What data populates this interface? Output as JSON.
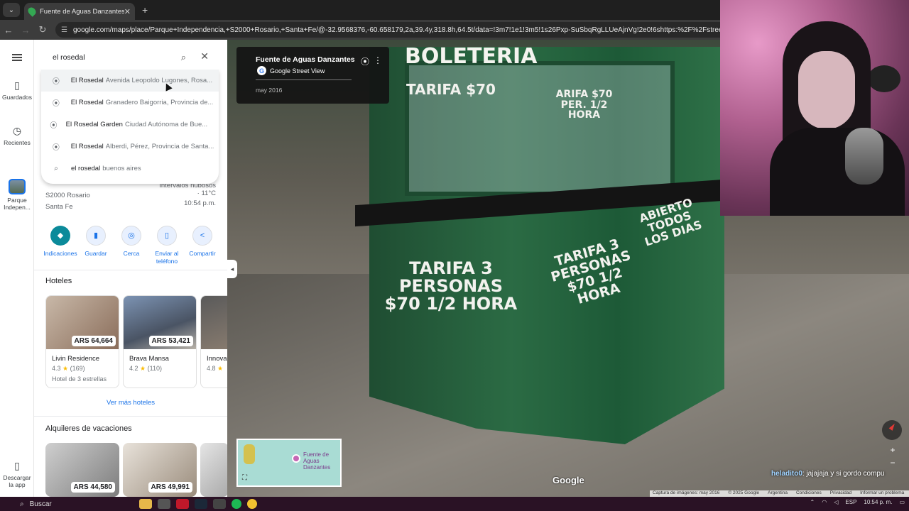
{
  "browser": {
    "tab_title": "Fuente de Aguas Danzantes - G",
    "tab_close": "✕",
    "new_tab": "+",
    "url": "google.com/maps/place/Parque+Independencia,+S2000+Rosario,+Santa+Fe/@-32.9568376,-60.658179,2a,39.4y,318.8h,64.5t/data=!3m7!1e1!3m5!1s26Pxp-SuSbqRgLLUeAjnVg!2e0!6shttps:%2F%2Fstreetviewpixels-pa.goo"
  },
  "rail": {
    "saved_label": "Guardados",
    "recent_label": "Recientes",
    "recent_place_label": "Parque Indepen...",
    "download_label": "Descargar la app"
  },
  "search": {
    "value": "el rosedal",
    "suggestions": [
      {
        "name": "El Rosedal",
        "addr": "Avenida Leopoldo Lugones, Rosa..."
      },
      {
        "name": "El Rosedal",
        "addr": "Granadero Baigorria, Provincia de..."
      },
      {
        "name": "El Rosedal Garden",
        "addr": "Ciudad Autónoma de Bue..."
      },
      {
        "name": "El Rosedal",
        "addr": "Alberdi, Pérez, Provincia de Santa..."
      }
    ],
    "query_suggestion": {
      "bold": "el rosedal",
      "rest": "buenos aires"
    }
  },
  "place": {
    "address_line1": "S2000 Rosario",
    "address_line2": "Santa Fe",
    "weather_line1": "Intervalos nubosos",
    "weather_line2": "· 11°C",
    "weather_time": "10:54 p.m."
  },
  "actions": [
    {
      "label": "Indicaciones",
      "icon": "◆"
    },
    {
      "label": "Guardar",
      "icon": "▮"
    },
    {
      "label": "Cerca",
      "icon": "◎"
    },
    {
      "label": "Enviar al teléfono",
      "icon": "▯"
    },
    {
      "label": "Compartir",
      "icon": "<"
    }
  ],
  "hotels": {
    "title": "Hoteles",
    "items": [
      {
        "name": "Livin Residence",
        "rating": "4.3",
        "reviews": "(169)",
        "stars": "Hotel de 3 estrellas",
        "price": "ARS 64,664"
      },
      {
        "name": "Brava Mansa",
        "rating": "4.2",
        "reviews": "(110)",
        "stars": "",
        "price": "ARS 53,421"
      },
      {
        "name": "Innova",
        "rating": "4.8",
        "reviews": "",
        "stars": "",
        "price": ""
      }
    ],
    "more": "Ver más hoteles"
  },
  "vacation": {
    "title": "Alquileres de vacaciones",
    "items": [
      {
        "price": "ARS 44,580"
      },
      {
        "price": "ARS 49,991"
      }
    ]
  },
  "streetview": {
    "place_title": "Fuente de Aguas Danzantes",
    "source": "Google Street View",
    "date": "may 2016",
    "kiosk_sign": "BOLETERIA",
    "kiosk_tarifa_top": "TARIFA $70",
    "kiosk_tarifa_side": "TARIFA 3 PERSONAS $70 1/2 HORA",
    "kiosk_right": "TARIFA 3 PERSONAS $70 1/2 HORA",
    "kiosk_abierto": "ABIERTO TODOS LOS DIAS",
    "kiosk_small": "ARIFA $70 PER. 1/2 HORA",
    "minimap_label": "Fuente de Aguas Danzantes",
    "google_logo": "Google",
    "footer": [
      "Captura de imágenes: may 2016",
      "© 2025 Google",
      "Argentina",
      "Condiciones",
      "Privacidad",
      "Informar un problema"
    ]
  },
  "chat": {
    "user": "heladito0",
    "message": ": jajajaja y si gordo compu"
  },
  "taskbar": {
    "search_label": "Buscar",
    "lang": "ESP",
    "time": "10:54 p. m."
  }
}
